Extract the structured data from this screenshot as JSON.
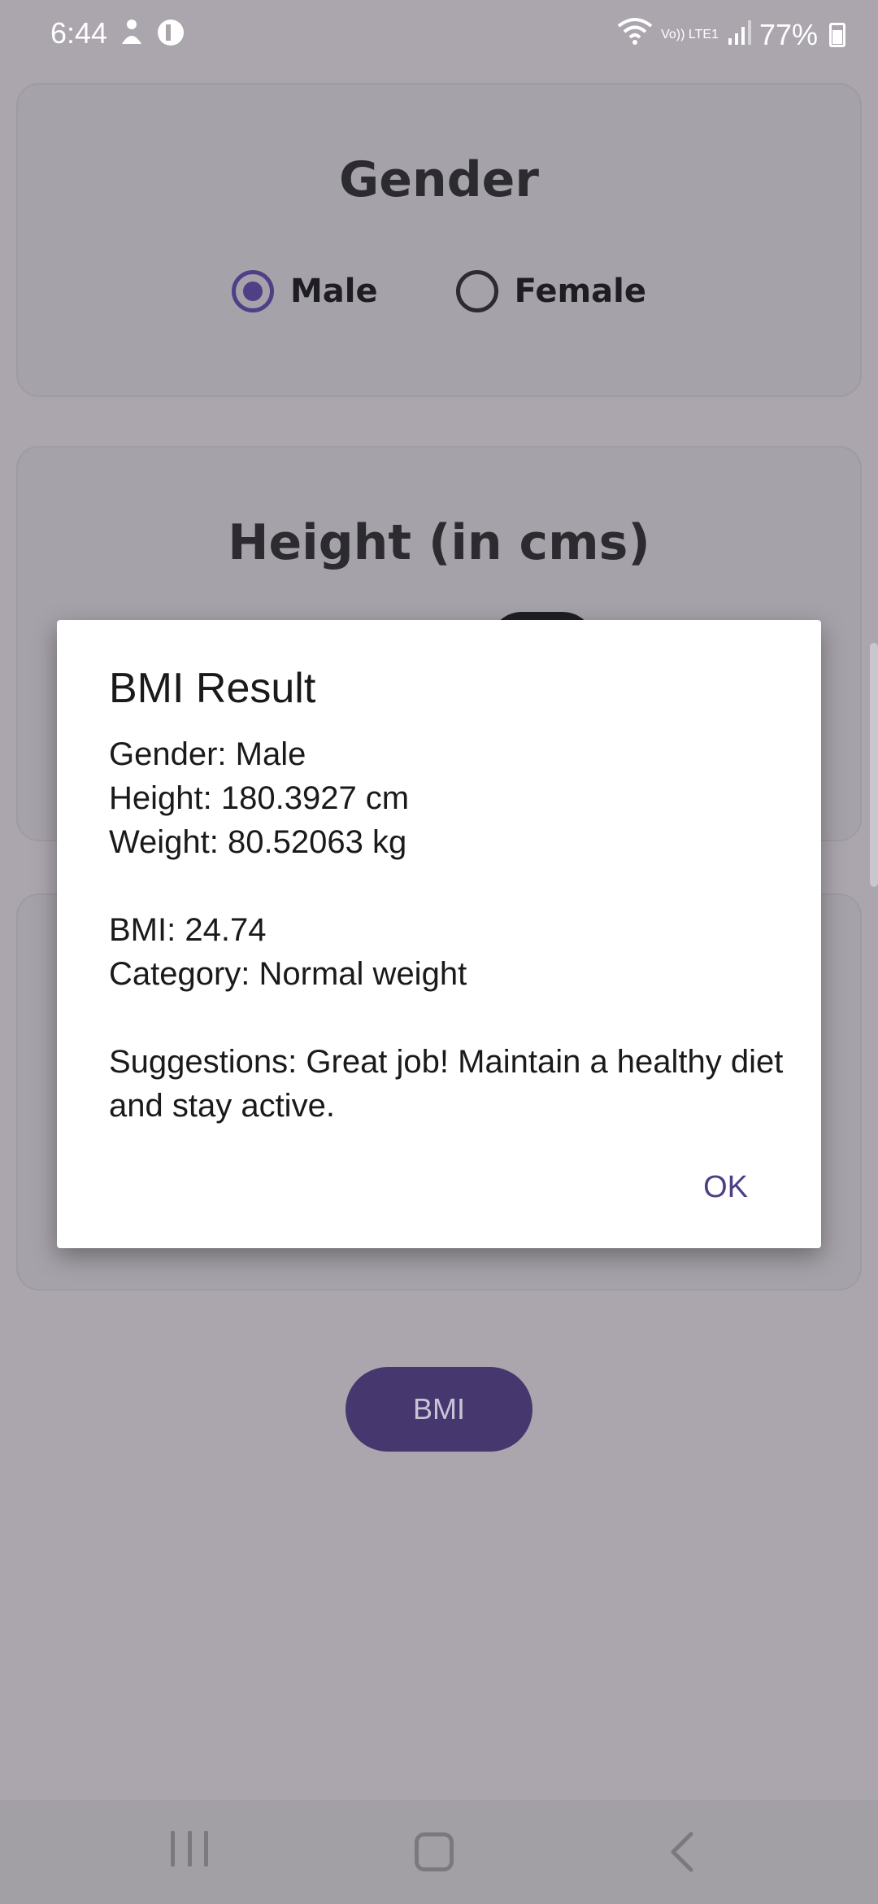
{
  "status_bar": {
    "time": "6:44",
    "network": "Vo)) LTE1",
    "battery": "77%"
  },
  "gender_card": {
    "title": "Gender",
    "options": [
      {
        "label": "Male",
        "selected": true
      },
      {
        "label": "Female",
        "selected": false
      }
    ]
  },
  "height_card": {
    "title": "Height (in cms)"
  },
  "bmi_button": {
    "label": "BMI"
  },
  "dialog": {
    "title": "BMI Result",
    "gender_line": "Gender: Male",
    "height_line": "Height: 180.3927 cm",
    "weight_line": "Weight: 80.52063 kg",
    "bmi_line": "BMI: 24.74",
    "category_line": "Category: Normal weight",
    "suggestion_line": "Suggestions: Great job! Maintain a healthy diet and stay active.",
    "ok_label": "OK"
  },
  "colors": {
    "accent": "#4f3f87",
    "scrim_background": "#aba6ad",
    "button": "#46386f"
  }
}
